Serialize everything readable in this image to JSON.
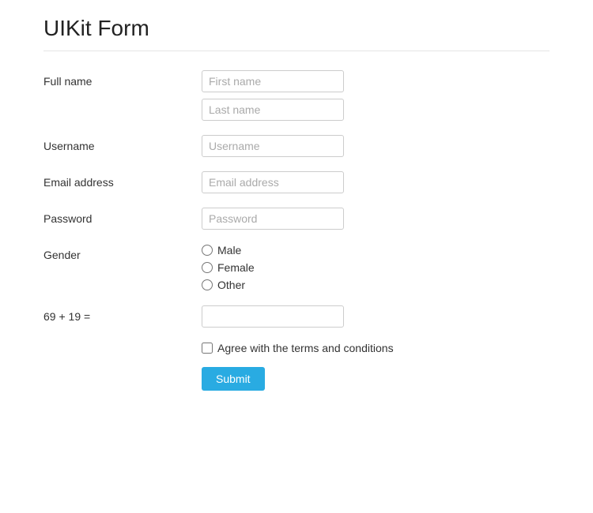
{
  "page": {
    "title": "UIKit Form"
  },
  "form": {
    "full_name_label": "Full name",
    "first_name_placeholder": "First name",
    "last_name_placeholder": "Last name",
    "username_label": "Username",
    "username_placeholder": "Username",
    "email_label": "Email address",
    "email_placeholder": "Email address",
    "password_label": "Password",
    "password_placeholder": "Password",
    "gender_label": "Gender",
    "gender_options": [
      "Male",
      "Female",
      "Other"
    ],
    "captcha_label": "69 + 19 =",
    "captcha_placeholder": "",
    "terms_label": "Agree with the terms and conditions",
    "submit_label": "Submit"
  }
}
